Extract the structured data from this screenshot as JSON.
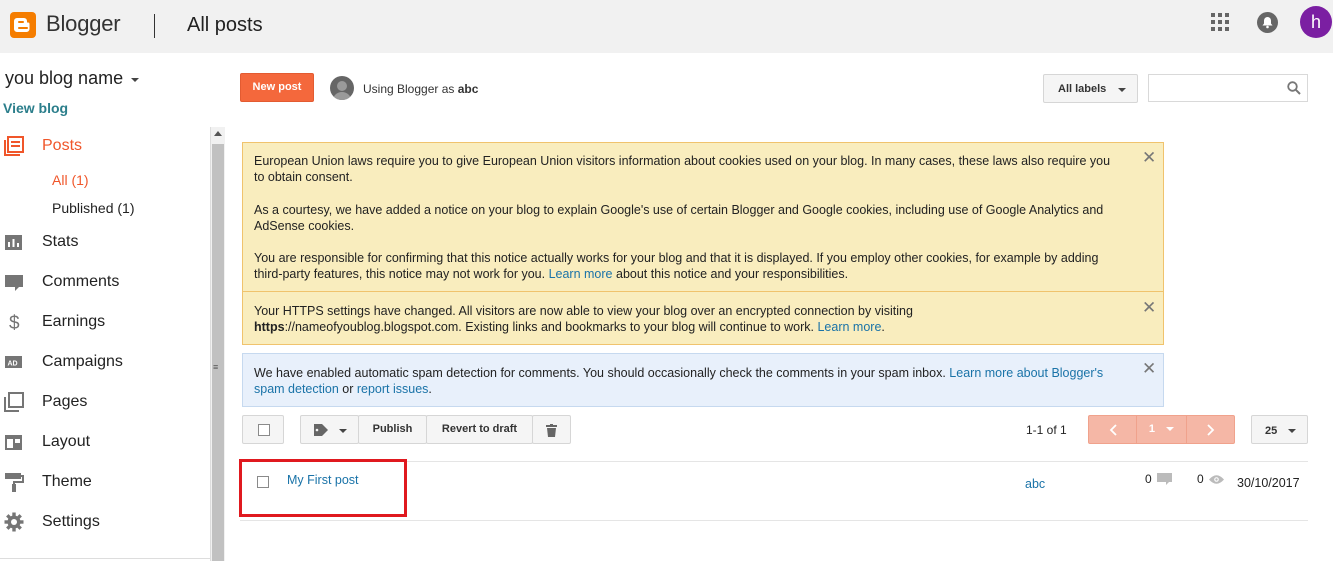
{
  "app": {
    "name": "Blogger",
    "page_title": "All posts",
    "avatar_letter": "h"
  },
  "sidebar": {
    "blog_name": "you blog name",
    "view_blog": "View blog",
    "items": [
      {
        "label": "Posts",
        "icon": "posts-icon",
        "active": true
      },
      {
        "label": "Stats",
        "icon": "stats-icon"
      },
      {
        "label": "Comments",
        "icon": "comments-icon"
      },
      {
        "label": "Earnings",
        "icon": "dollar-icon"
      },
      {
        "label": "Campaigns",
        "icon": "ad-icon"
      },
      {
        "label": "Pages",
        "icon": "pages-icon"
      },
      {
        "label": "Layout",
        "icon": "layout-icon"
      },
      {
        "label": "Theme",
        "icon": "paint-roller-icon"
      },
      {
        "label": "Settings",
        "icon": "gear-icon"
      }
    ],
    "posts_sub": [
      {
        "label": "All (1)",
        "active": true
      },
      {
        "label": "Published (1)"
      }
    ]
  },
  "toolbar": {
    "new_post": "New post",
    "using_prefix": "Using Blogger as ",
    "username": "abc",
    "labels_button": "All labels",
    "search_placeholder": ""
  },
  "notices": {
    "cookies": {
      "p1": "European Union laws require you to give European Union visitors information about cookies used on your blog. In many cases, these laws also require you to obtain consent.",
      "p2": "As a courtesy, we have added a notice on your blog to explain Google's use of certain Blogger and Google cookies, including use of Google Analytics and AdSense cookies.",
      "p3_a": "You are responsible for confirming that this notice actually works for your blog and that it is displayed. If you employ other cookies, for example by adding third-party features, this notice may not work for you. ",
      "p3_link": "Learn more",
      "p3_b": " about this notice and your responsibilities."
    },
    "https": {
      "a": "Your HTTPS settings have changed. All visitors are now able to view your blog over an encrypted connection by visiting ",
      "bold": "https",
      "b": "://nameofyoublog.blogspot.com. Existing links and bookmarks to your blog will continue to work. ",
      "link": "Learn more",
      "c": "."
    },
    "spam": {
      "a": "We have enabled automatic spam detection for comments. You should occasionally check the comments in your spam inbox. ",
      "link1": "Learn more about Blogger's spam detection",
      "b": " or ",
      "link2": "report issues",
      "c": "."
    },
    "close_glyph": "✕"
  },
  "posts_toolbar": {
    "publish": "Publish",
    "revert": "Revert to draft",
    "range": "1-1 of 1",
    "page": "1",
    "per_page": "25"
  },
  "posts": [
    {
      "title": "My First post",
      "author": "abc",
      "comments": "0",
      "views": "0",
      "date": "30/10/2017"
    }
  ],
  "colors": {
    "accent": "#f4683c",
    "link": "#1a73a8",
    "highlight": "#e0191f"
  }
}
